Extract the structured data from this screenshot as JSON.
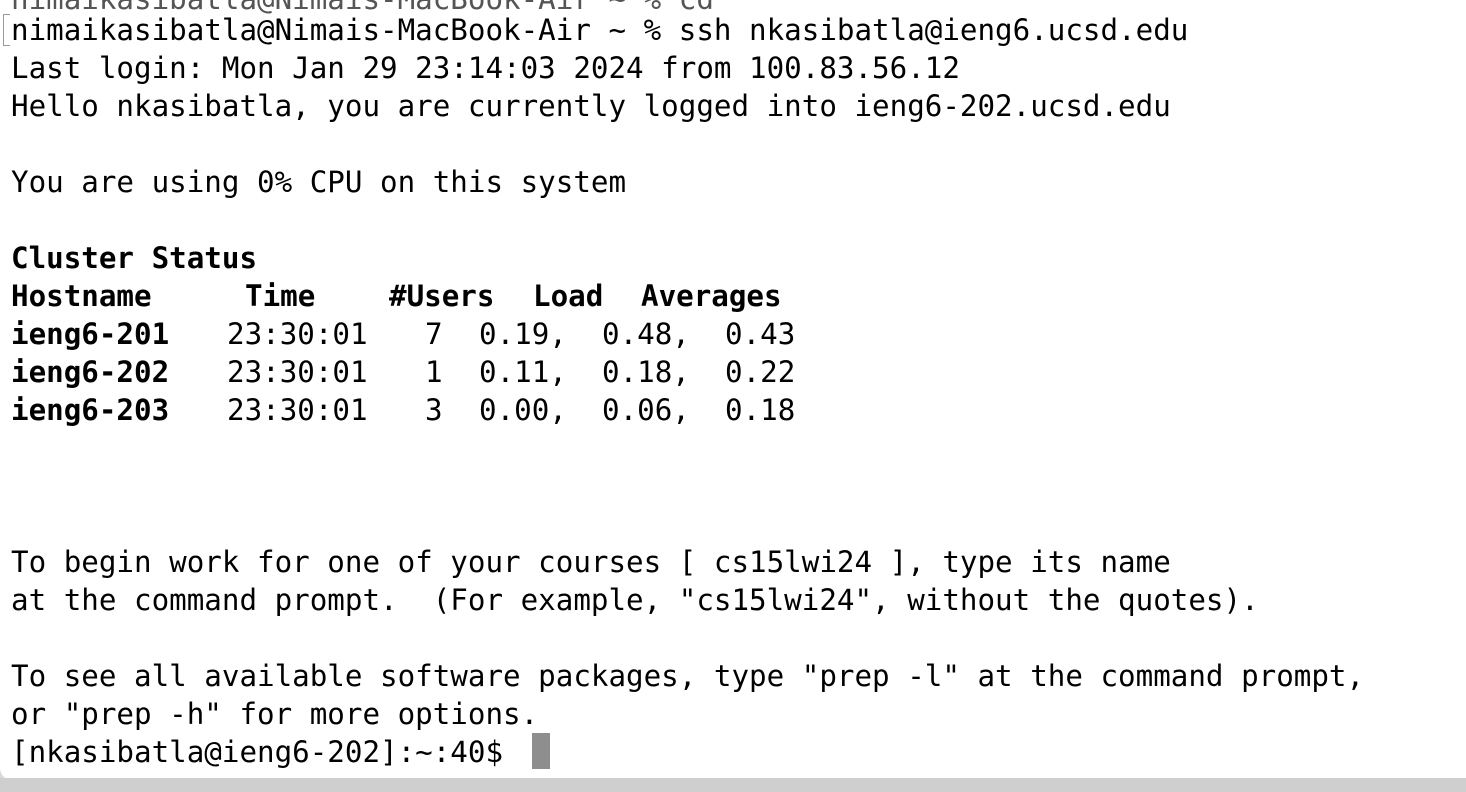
{
  "terminal": {
    "partial_top_line": "nimaikasibatla@Nimais-MacBook-Air ~ % cd",
    "ssh_command_line": "nimaikasibatla@Nimais-MacBook-Air ~ % ssh nkasibatla@ieng6.ucsd.edu",
    "last_login": "Last login: Mon Jan 29 23:14:03 2024 from 100.83.56.12",
    "hello": "Hello nkasibatla, you are currently logged into ieng6-202.ucsd.edu",
    "cpu": "You are using 0% CPU on this system",
    "cluster_title": "Cluster Status",
    "table": {
      "headers": [
        "Hostname",
        "Time",
        "#Users",
        "Load",
        "Averages"
      ],
      "rows": [
        {
          "host": "ieng6-201",
          "time": "23:30:01",
          "users": "7",
          "loads": "0.19,  0.48,  0.43"
        },
        {
          "host": "ieng6-202",
          "time": "23:30:01",
          "users": "1",
          "loads": "0.11,  0.18,  0.22"
        },
        {
          "host": "ieng6-203",
          "time": "23:30:01",
          "users": "3",
          "loads": "0.00,  0.06,  0.18"
        }
      ]
    },
    "courses_line1": "To begin work for one of your courses [ cs15lwi24 ], type its name",
    "courses_line2": "at the command prompt.  (For example, \"cs15lwi24\", without the quotes).",
    "prep_line1": "To see all available software packages, type \"prep -l\" at the command prompt,",
    "prep_line2": "or \"prep -h\" for more options.",
    "prompt": "[nkasibatla@ieng6-202]:~:40$ "
  }
}
